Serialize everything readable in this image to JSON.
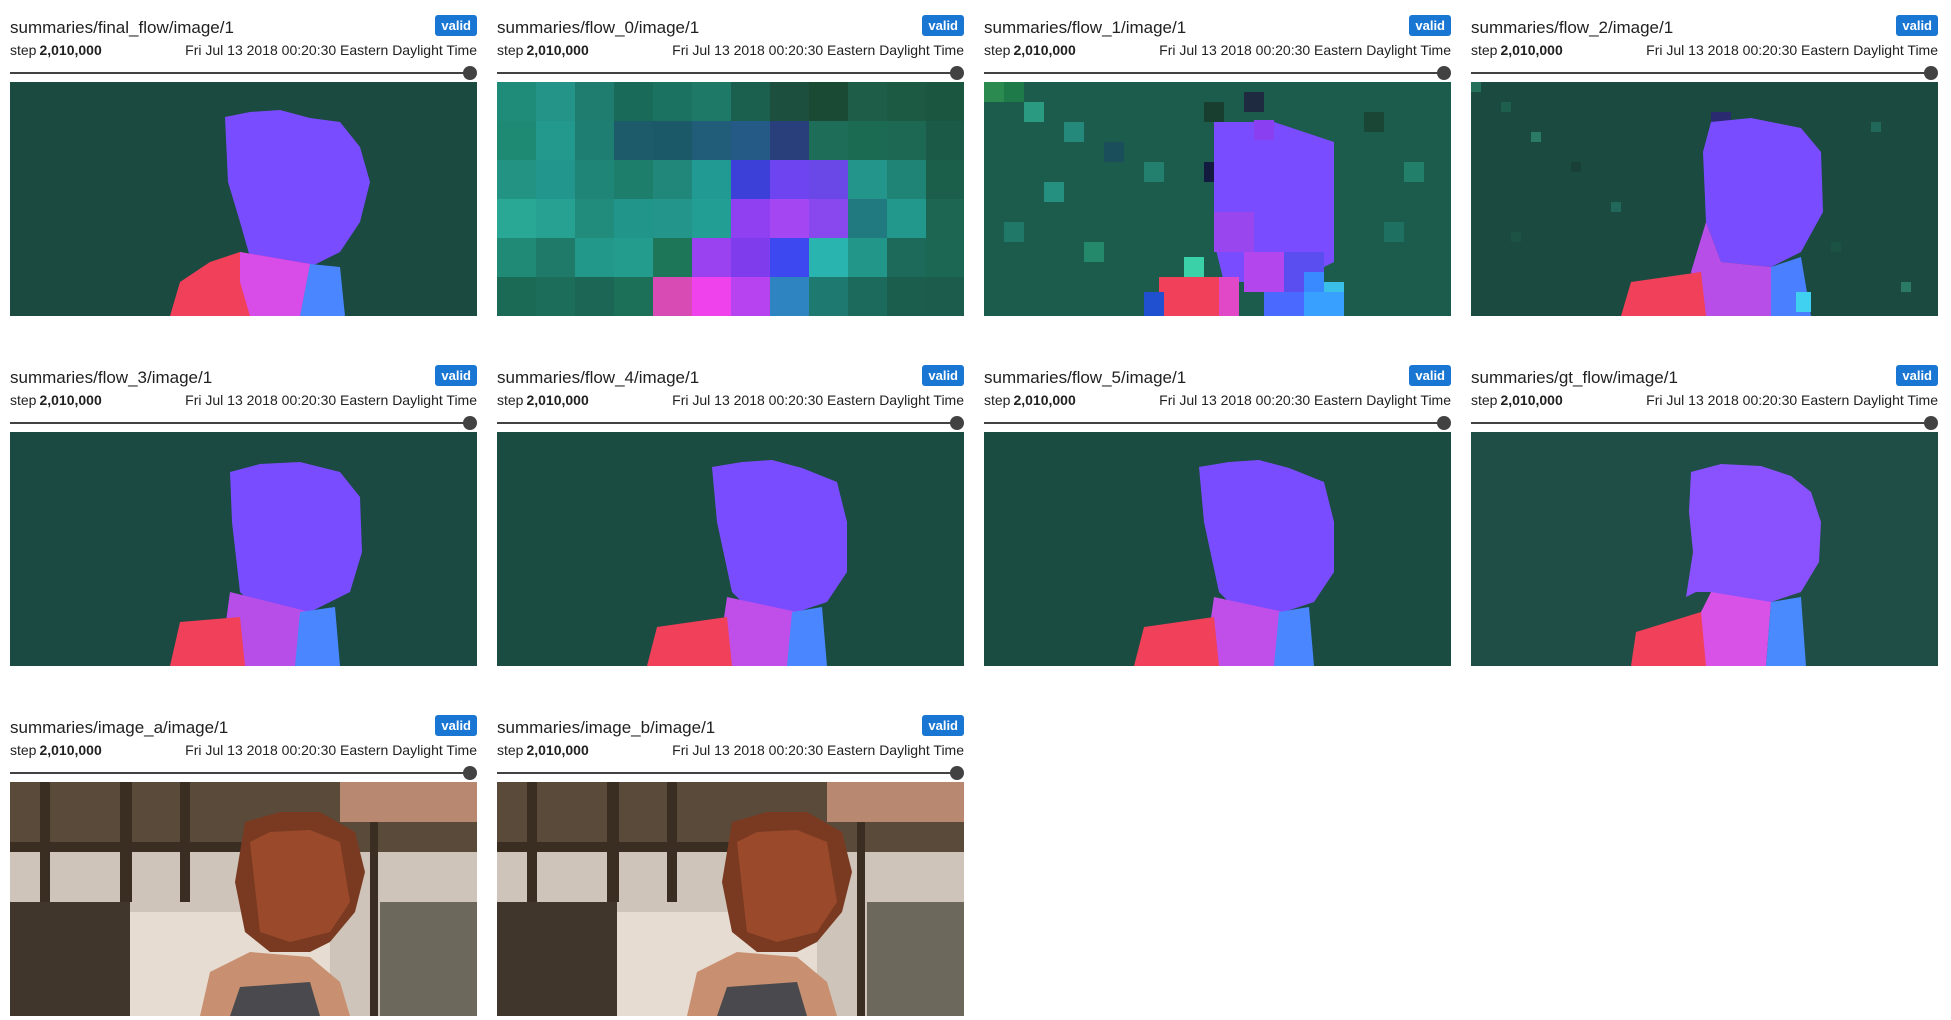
{
  "cards": [
    {
      "title": "summaries/final_flow/image/1",
      "badge": "valid",
      "step_label": "step",
      "step": "2,010,000",
      "time": "Fri Jul 13 2018 00:20:30 Eastern Daylight Time",
      "image_subject": "optical flow visualization, person silhouette"
    },
    {
      "title": "summaries/flow_0/image/1",
      "badge": "valid",
      "step_label": "step",
      "step": "2,010,000",
      "time": "Fri Jul 13 2018 00:20:30 Eastern Daylight Time",
      "image_subject": "coarse blocky optical flow visualization"
    },
    {
      "title": "summaries/flow_1/image/1",
      "badge": "valid",
      "step_label": "step",
      "step": "2,010,000",
      "time": "Fri Jul 13 2018 00:20:30 Eastern Daylight Time",
      "image_subject": "pixelated optical flow visualization"
    },
    {
      "title": "summaries/flow_2/image/1",
      "badge": "valid",
      "step_label": "step",
      "step": "2,010,000",
      "time": "Fri Jul 13 2018 00:20:30 Eastern Daylight Time",
      "image_subject": "pixelated optical flow visualization"
    },
    {
      "title": "summaries/flow_3/image/1",
      "badge": "valid",
      "step_label": "step",
      "step": "2,010,000",
      "time": "Fri Jul 13 2018 00:20:30 Eastern Daylight Time",
      "image_subject": "optical flow visualization"
    },
    {
      "title": "summaries/flow_4/image/1",
      "badge": "valid",
      "step_label": "step",
      "step": "2,010,000",
      "time": "Fri Jul 13 2018 00:20:30 Eastern Daylight Time",
      "image_subject": "optical flow visualization"
    },
    {
      "title": "summaries/flow_5/image/1",
      "badge": "valid",
      "step_label": "step",
      "step": "2,010,000",
      "time": "Fri Jul 13 2018 00:20:30 Eastern Daylight Time",
      "image_subject": "optical flow visualization"
    },
    {
      "title": "summaries/gt_flow/image/1",
      "badge": "valid",
      "step_label": "step",
      "step": "2,010,000",
      "time": "Fri Jul 13 2018 00:20:30 Eastern Daylight Time",
      "image_subject": "ground truth optical flow visualization"
    },
    {
      "title": "summaries/image_a/image/1",
      "badge": "valid",
      "step_label": "step",
      "step": "2,010,000",
      "time": "Fri Jul 13 2018 00:20:30 Eastern Daylight Time",
      "image_subject": "rendered scene, woman with red hair"
    },
    {
      "title": "summaries/image_b/image/1",
      "badge": "valid",
      "step_label": "step",
      "step": "2,010,000",
      "time": "Fri Jul 13 2018 00:20:30 Eastern Daylight Time",
      "image_subject": "rendered scene, woman with red hair"
    }
  ],
  "colors": {
    "badge": "#1976d2",
    "slider": "#424242",
    "flow_background": "#1b4a40",
    "flow_head": "#7a4cff",
    "flow_body": "#f0405a",
    "flow_neck": "#e04ee8",
    "flow_collar": "#3aa0ff"
  }
}
